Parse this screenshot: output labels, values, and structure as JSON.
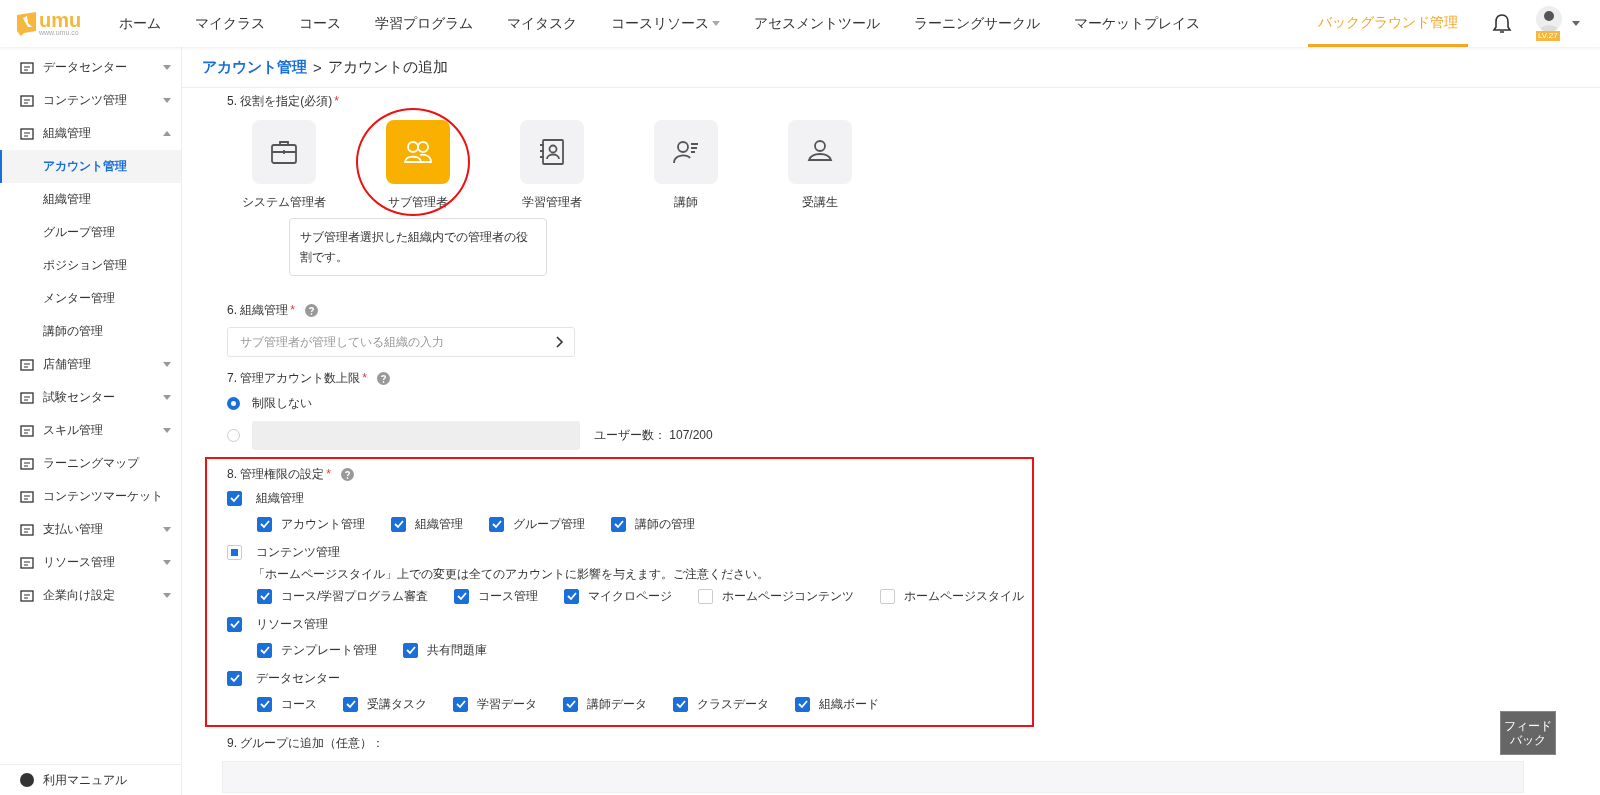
{
  "header": {
    "logo": "umu",
    "logo_sub": "www.umu.co",
    "nav": [
      {
        "label": "ホーム",
        "selected": false,
        "dropdown": false
      },
      {
        "label": "マイクラス",
        "selected": false,
        "dropdown": false
      },
      {
        "label": "コース",
        "selected": false,
        "dropdown": false
      },
      {
        "label": "学習プログラム",
        "selected": false,
        "dropdown": false
      },
      {
        "label": "マイタスク",
        "selected": false,
        "dropdown": false
      },
      {
        "label": "コースリソース",
        "selected": false,
        "dropdown": true
      },
      {
        "label": "アセスメントツール",
        "selected": false,
        "dropdown": false
      },
      {
        "label": "ラーニングサークル",
        "selected": false,
        "dropdown": false
      },
      {
        "label": "マーケットプレイス",
        "selected": false,
        "dropdown": false
      }
    ],
    "admin": {
      "label": "バックグラウンド管理",
      "selected": true
    },
    "level_badge": "LV.27"
  },
  "sidebar": {
    "items": [
      {
        "label": "データセンター",
        "kind": "menu",
        "expanded": false
      },
      {
        "label": "コンテンツ管理",
        "kind": "menu",
        "expanded": false
      },
      {
        "label": "組織管理",
        "kind": "menu",
        "expanded": true,
        "children": [
          {
            "label": "アカウント管理",
            "selected": true
          },
          {
            "label": "組織管理",
            "selected": false
          },
          {
            "label": "グループ管理",
            "selected": false
          },
          {
            "label": "ポジション管理",
            "selected": false
          },
          {
            "label": "メンター管理",
            "selected": false
          },
          {
            "label": "講師の管理",
            "selected": false
          }
        ]
      },
      {
        "label": "店舗管理",
        "kind": "menu",
        "expanded": false
      },
      {
        "label": "試験センター",
        "kind": "menu",
        "expanded": false
      },
      {
        "label": "スキル管理",
        "kind": "menu",
        "expanded": false
      },
      {
        "label": "ラーニングマップ",
        "kind": "link"
      },
      {
        "label": "コンテンツマーケット",
        "kind": "link"
      },
      {
        "label": "支払い管理",
        "kind": "menu",
        "expanded": false
      },
      {
        "label": "リソース管理",
        "kind": "menu",
        "expanded": false
      },
      {
        "label": "企業向け設定",
        "kind": "menu",
        "expanded": false
      }
    ],
    "footer": "利用マニュアル"
  },
  "breadcrumb": {
    "parent": "アカウント管理",
    "separator": ">",
    "current": "アカウントの追加"
  },
  "role_section": {
    "label": "5. 役割を指定(必須)",
    "required": "*",
    "roles": [
      {
        "label": "システム管理者",
        "selected": false
      },
      {
        "label": "サブ管理者",
        "selected": true
      },
      {
        "label": "学習管理者",
        "selected": false
      },
      {
        "label": "講師",
        "selected": false
      },
      {
        "label": "受講生",
        "selected": false
      }
    ],
    "tooltip": "サブ管理者選択した組織内での管理者の役割です。"
  },
  "org_section": {
    "label": "6. 組織管理",
    "required": "*",
    "placeholder": "サブ管理者が管理している組織の入力"
  },
  "limit_section": {
    "label": "7. 管理アカウント数上限",
    "required": "*",
    "options": [
      {
        "label": "制限しない",
        "selected": true
      },
      {
        "selected": false,
        "note": "ユーザー数： 107/200"
      }
    ]
  },
  "permission_section": {
    "label": "8. 管理権限の設定",
    "required": "*",
    "groups": [
      {
        "label": "組織管理",
        "checked": true,
        "items": [
          {
            "label": "アカウント管理",
            "checked": true
          },
          {
            "label": "組織管理",
            "checked": true
          },
          {
            "label": "グループ管理",
            "checked": true
          },
          {
            "label": "講師の管理",
            "checked": true
          }
        ]
      },
      {
        "label": "コンテンツ管理",
        "partial": true,
        "note": "「ホームページスタイル」上での変更は全てのアカウントに影響を与えます。ご注意ください。",
        "items": [
          {
            "label": "コース/学習プログラム審査",
            "checked": true
          },
          {
            "label": "コース管理",
            "checked": true
          },
          {
            "label": "マイクロページ",
            "checked": true
          },
          {
            "label": "ホームページコンテンツ",
            "checked": false
          },
          {
            "label": "ホームページスタイル",
            "checked": false
          }
        ]
      },
      {
        "label": "リソース管理",
        "checked": true,
        "items": [
          {
            "label": "テンプレート管理",
            "checked": true
          },
          {
            "label": "共有問題庫",
            "checked": true
          }
        ]
      },
      {
        "label": "データセンター",
        "checked": true,
        "items": [
          {
            "label": "コース",
            "checked": true
          },
          {
            "label": "受講タスク",
            "checked": true
          },
          {
            "label": "学習データ",
            "checked": true
          },
          {
            "label": "講師データ",
            "checked": true
          },
          {
            "label": "クラスデータ",
            "checked": true
          },
          {
            "label": "組織ボード",
            "checked": true
          }
        ]
      }
    ]
  },
  "group_section": {
    "label": "9. グループに追加（任意）："
  },
  "feedback": "フィードバック"
}
